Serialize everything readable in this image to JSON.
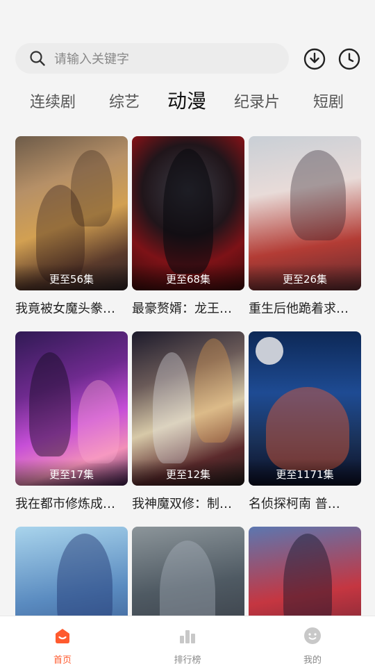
{
  "search": {
    "placeholder": "请输入关键字"
  },
  "header": {
    "download_icon": "download-icon",
    "history_icon": "clock-icon"
  },
  "tabs": [
    {
      "label": "连续剧",
      "active": false
    },
    {
      "label": "综艺",
      "active": false
    },
    {
      "label": "动漫",
      "active": true
    },
    {
      "label": "纪录片",
      "active": false
    },
    {
      "label": "短剧",
      "active": false
    }
  ],
  "cards": [
    {
      "title": "我竟被女魔头豢…",
      "episodes": "更至56集"
    },
    {
      "title": "最豪赘婿：龙王…",
      "episodes": "更至68集"
    },
    {
      "title": "重生后他跪着求…",
      "episodes": "更至26集"
    },
    {
      "title": "我在都市修炼成…",
      "episodes": "更至17集"
    },
    {
      "title": "我神魔双修：制…",
      "episodes": "更至12集"
    },
    {
      "title": "名侦探柯南 普…",
      "episodes": "更至1171集"
    },
    {
      "title": "",
      "episodes": ""
    },
    {
      "title": "",
      "episodes": ""
    },
    {
      "title": "",
      "episodes": ""
    }
  ],
  "bottom_nav": [
    {
      "label": "首页",
      "icon": "home-icon",
      "active": true
    },
    {
      "label": "排行榜",
      "icon": "bar-chart-icon",
      "active": false
    },
    {
      "label": "我的",
      "icon": "smiley-icon",
      "active": false
    }
  ],
  "colors": {
    "accent": "#ff5a2e",
    "background": "#f4f4f4",
    "inactive": "#888888"
  }
}
